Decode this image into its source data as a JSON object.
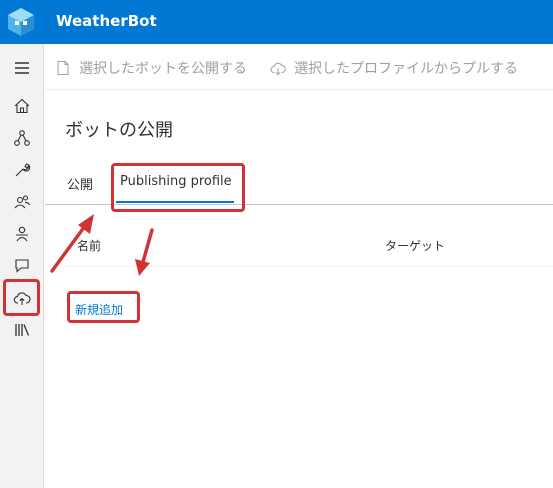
{
  "app": {
    "title": "WeatherBot"
  },
  "toolbar": {
    "publish_label": "選択したボットを公開する",
    "pull_label": "選択したプロファイルからプルする"
  },
  "page": {
    "title": "ボットの公開"
  },
  "tabs": [
    {
      "label": "公開",
      "selected": false
    },
    {
      "label": "Publishing profile",
      "selected": true
    }
  ],
  "table": {
    "columns": [
      "名前",
      "ターゲット"
    ],
    "add_new_label": "新規追加"
  },
  "sidebar": {
    "items": [
      {
        "icon": "home-icon"
      },
      {
        "icon": "design-flow-icon"
      },
      {
        "icon": "wrench-icon"
      },
      {
        "icon": "users-icon"
      },
      {
        "icon": "bot-test-icon"
      },
      {
        "icon": "chat-icon"
      },
      {
        "icon": "cloud-upload-icon",
        "active": true
      },
      {
        "icon": "library-icon"
      }
    ]
  },
  "colors": {
    "accent": "#0078d4",
    "annotation_red": "#d13438"
  }
}
